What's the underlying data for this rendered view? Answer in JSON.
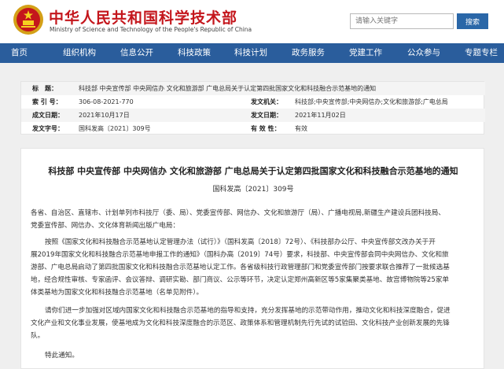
{
  "header": {
    "title": "中华人民共和国科学技术部",
    "subtitle": "Ministry of Science and Technology of the People's Republic of China",
    "search_placeholder": "请输入关键字",
    "search_button": "搜索",
    "emblem_icon": "national-emblem-icon"
  },
  "nav": {
    "items": [
      "首页",
      "组织机构",
      "信息公开",
      "科技政策",
      "科技计划",
      "政务服务",
      "党建工作",
      "公众参与",
      "专题专栏"
    ]
  },
  "meta": {
    "title_label": "标　题：",
    "title_value": "科技部 中央宣传部 中央网信办 文化和旅游部 广电总局关于认定第四批国家文化和科技融合示范基地的通知",
    "index_label": "索 引 号：",
    "index_value": "306-08-2021-770",
    "issuer_label": "发文机关：",
    "issuer_value": "科技部;中央宣传部;中央网信办;文化和旅游部;广电总局",
    "created_label": "成文日期：",
    "created_value": "2021年10月17日",
    "published_label": "发文日期：",
    "published_value": "2021年11月02日",
    "docno_label": "发文字号：",
    "docno_value": "国科发高〔2021〕309号",
    "validity_label": "有 效 性：",
    "validity_value": "有效"
  },
  "article": {
    "title": "科技部 中央宣传部 中央网信办 文化和旅游部 广电总局关于认定第四批国家文化和科技融合示范基地的通知",
    "doc_number": "国科发高〔2021〕309号",
    "lines": [
      "各省、自治区、直辖市、计划单列市科技厅（委、局）、党委宣传部、网信办、文化和旅游厅（局）、广播电视局,新疆生产建设兵团科技局、",
      "党委宣传部、网信办、文化体育新闻出版广电局：",
      "按照《国家文化和科技融合示范基地认定管理办法（试行）》（国科发高〔2018〕72号）、《科技部办公厅、中央宣传部文改办关于开",
      "展2019年国家文化和科技融合示范基地申报工作的通知》（国科办高〔2019〕74号）要求，科技部、中央宣传部会同中央网信办、文化和旅",
      "游部、广电总局启动了第四批国家文化和科技融合示范基地认定工作。各省级科技行政管理部门和党委宣传部门按要求联合推荐了一批候选基",
      "地，经合规性审核、专家函评、会议答辩、调研实勘、部门商议、公示等环节，决定认定郑州高新区等5家集聚类基地、故宫博物院等25家单",
      "体类基地为国家文化和科技融合示范基地（名单见附件）。",
      "请你们进一步加强对区域内国家文化和科技融合示范基地的指导和支持，充分发挥基地的示范带动作用，推动文化和科技深度融合，促进",
      "文化产业和文化事业发展，使基地成为文化和科技深度融合的示范区、政策体系和管理机制先行先试的试验田、文化科技产业创新发展的先锋",
      "队。",
      "特此通知。"
    ]
  }
}
